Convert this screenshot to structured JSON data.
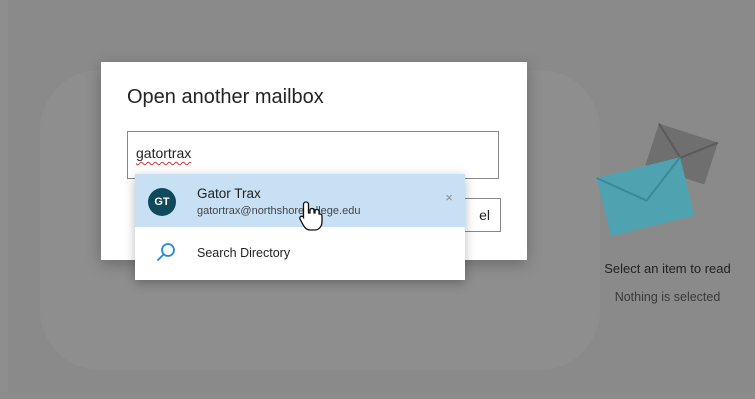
{
  "dialog": {
    "title": "Open another mailbox",
    "input_value": "gatortrax",
    "cancel_label": "el"
  },
  "suggestions": {
    "contact": {
      "initials": "GT",
      "name": "Gator Trax",
      "email": "gatortrax@northshorecollege.edu",
      "remove_glyph": "×"
    },
    "search_directory_label": "Search Directory"
  },
  "reading_pane": {
    "title": "Select an item to read",
    "subtitle": "Nothing is selected"
  },
  "colors": {
    "overlay": "#8a8a8a",
    "highlight": "#c7e0f4",
    "avatar": "#0f4a5c",
    "search_icon": "#2b88d8",
    "envelope_front": "#4fa3b0",
    "envelope_back": "#6f6f6f"
  },
  "icons": [
    "envelope-illustration",
    "search-icon",
    "close-icon",
    "hand-cursor-icon"
  ]
}
